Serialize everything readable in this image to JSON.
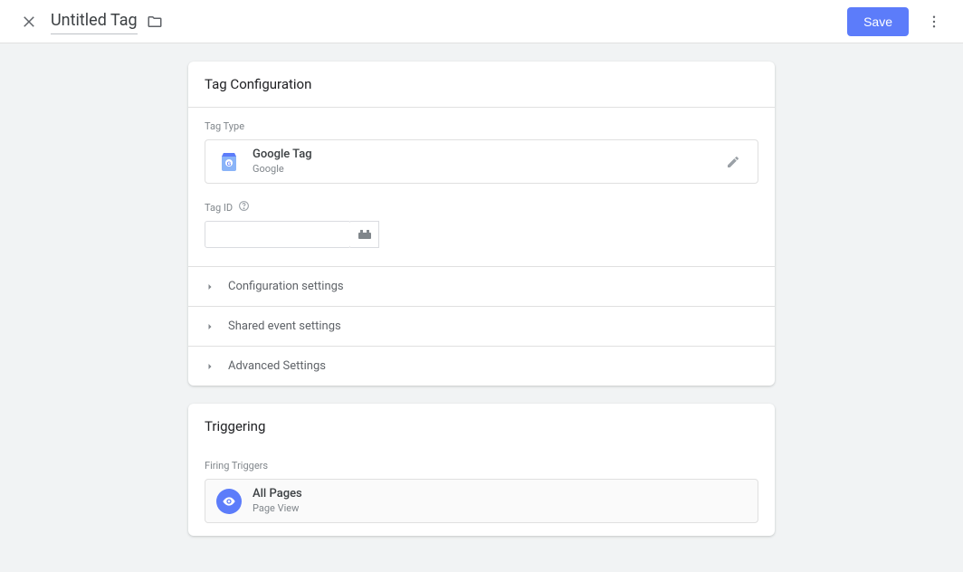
{
  "header": {
    "title": "Untitled Tag",
    "save_label": "Save"
  },
  "config": {
    "card_title": "Tag Configuration",
    "tag_type_label": "Tag Type",
    "tag_type_name": "Google Tag",
    "tag_type_vendor": "Google",
    "tag_id_label": "Tag ID",
    "tag_id_value": "",
    "expanders": [
      "Configuration settings",
      "Shared event settings",
      "Advanced Settings"
    ]
  },
  "triggering": {
    "card_title": "Triggering",
    "section_label": "Firing Triggers",
    "trigger_name": "All Pages",
    "trigger_type": "Page View"
  }
}
